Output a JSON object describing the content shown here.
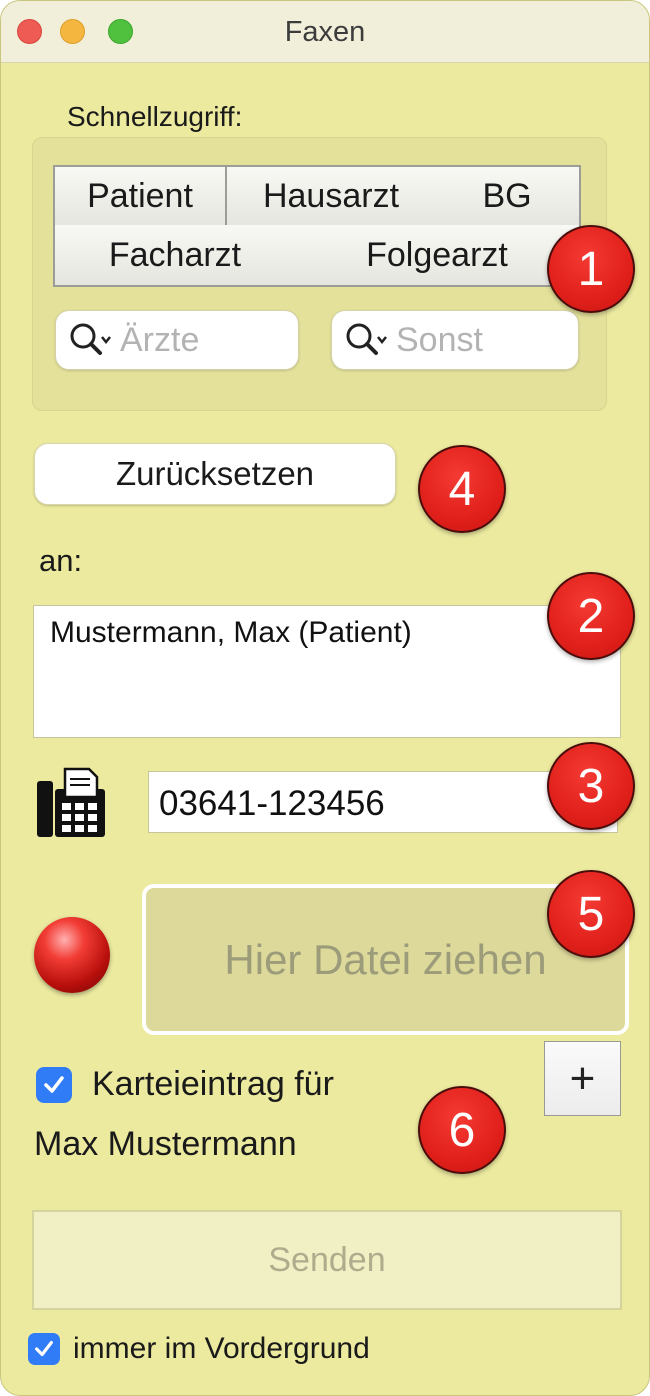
{
  "window": {
    "title": "Faxen"
  },
  "quick_access": {
    "label": "Schnellzugriff:",
    "buttons": [
      "Patient",
      "Hausarzt",
      "BG",
      "Facharzt",
      "Folgearzt"
    ],
    "search_doctors_placeholder": "Ärzte",
    "search_other_placeholder": "Sonst"
  },
  "reset_button": "Zurücksetzen",
  "recipient": {
    "label": "an:",
    "value": "Mustermann, Max (Patient)"
  },
  "fax_number": "03641-123456",
  "dropzone": {
    "text": "Hier Datei ziehen"
  },
  "add_button": "+",
  "chart_entry": {
    "checked": true,
    "line1": "Karteieintrag für",
    "line2": "Max Mustermann"
  },
  "send_button": "Senden",
  "always_on_top": {
    "checked": true,
    "label": "immer im Vordergrund"
  },
  "callouts": [
    "1",
    "2",
    "3",
    "4",
    "5",
    "6"
  ],
  "colors": {
    "window_bg": "#ecea9f",
    "callout": "#e1201b",
    "checkbox": "#2f7cf6",
    "led": "#f23d35"
  }
}
